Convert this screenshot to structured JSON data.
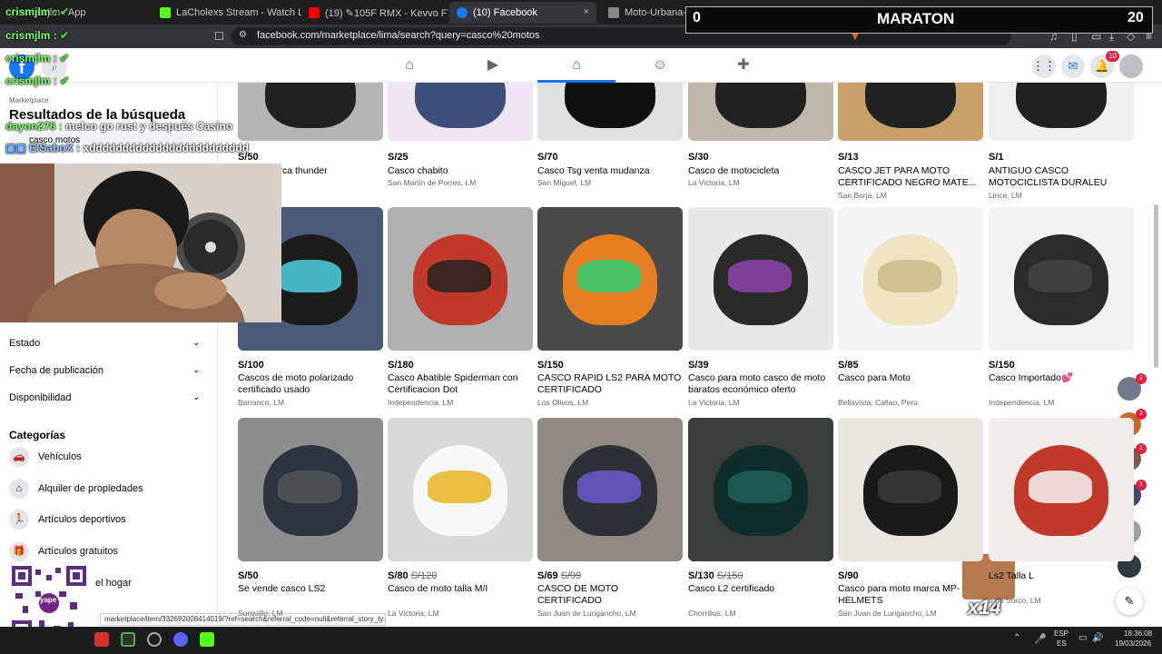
{
  "browser": {
    "tabs": [
      {
        "label": "crismjlm : App",
        "fav": "#333"
      },
      {
        "label": "LaCholexs Stream - Watch Live on Ki",
        "fav": "#53fc18"
      },
      {
        "label": "(19) ✎105F RMX - Kevvo FT Chench",
        "fav": "#ff0000"
      },
      {
        "label": "(10) Facebook",
        "fav": "#1877f2"
      },
      {
        "label": "Moto-Urbana-NK-250-1600X650.jp",
        "fav": "#888"
      }
    ],
    "new_tab": "+",
    "url": "facebook.com/marketplace/lima/search?query=casco%20motos",
    "close": "×"
  },
  "fb": {
    "notif_count": "10",
    "marketplace_label": "Marketplace",
    "search_results_title": "Resultados de la búsqueda",
    "search_query": "casco motos"
  },
  "sidebar": {
    "filters": [
      {
        "label": "Estado"
      },
      {
        "label": "Fecha de publicación"
      },
      {
        "label": "Disponibilidad"
      }
    ],
    "categories_title": "Categorías",
    "categories": [
      {
        "label": "Vehículos",
        "icon": "car-icon"
      },
      {
        "label": "Alquiler de propiedades",
        "icon": "home-icon"
      },
      {
        "label": "Artículos deportivos",
        "icon": "running-icon"
      },
      {
        "label": "Artículos gratuitos",
        "icon": "gift-icon"
      },
      {
        "label": "el hogar",
        "icon": "sofa-icon"
      }
    ]
  },
  "top_row": [
    {
      "price": "S/50",
      "title": "ficado marca thunder",
      "loc": ""
    },
    {
      "price": "S/25",
      "title": "Casco chabito",
      "loc": "San Martín de Porres, LM"
    },
    {
      "price": "S/70",
      "title": "Casco Tsg venta mudanza",
      "loc": "San Miguel, LM"
    },
    {
      "price": "S/30",
      "title": "Casco de motocicleta",
      "loc": "La Victoria, LM"
    },
    {
      "price": "S/13",
      "title": "CASCO JET PARA MOTO CERTIFICADO NEGRO MATE...",
      "loc": "San Borja, LM"
    },
    {
      "price": "S/1",
      "title": "ANTIGUO CASCO MOTOCICLISTA DURALEU FORTE",
      "loc": "Lince, LM"
    }
  ],
  "mid_row": [
    {
      "price": "S/100",
      "old": "",
      "title": "Cascos de moto polarizado certificado usado",
      "loc": "Barranco, LM"
    },
    {
      "price": "S/180",
      "old": "",
      "title": "Casco Abatible Spiderman con Certificacion Dot",
      "loc": "Independencia, LM"
    },
    {
      "price": "S/150",
      "old": "",
      "title": "CASCO RAPID LS2 PARA MOTO CERTIFICADO",
      "loc": "Los Olivos, LM"
    },
    {
      "price": "S/39",
      "old": "",
      "title": "Casco para moto casco de moto baratos económico oferto",
      "loc": "La Victoria, LM"
    },
    {
      "price": "S/85",
      "old": "",
      "title": "Casco para Moto",
      "loc": "Bellavista, Callao, Peru"
    },
    {
      "price": "S/150",
      "old": "",
      "title": "Casco Importado💕",
      "loc": "Independencia, LM"
    }
  ],
  "bot_row": [
    {
      "price": "S/50",
      "old": "",
      "title": "Se vende casco LS2",
      "loc": "Surquillo, LM"
    },
    {
      "price": "S/80",
      "old": "S/120",
      "title": "Casco de moto talla M/I",
      "loc": "La Victoria, LM"
    },
    {
      "price": "S/69",
      "old": "S/99",
      "title": "CASCO DE MOTO CERTIFICADO",
      "loc": "San Juan de Lurigancho, LM"
    },
    {
      "price": "S/130",
      "old": "S/150",
      "title": "Casco L2 certificado",
      "loc": "Chorrillos, LM"
    },
    {
      "price": "S/90",
      "old": "",
      "title": "Casco para moto marca MP-HELMETS",
      "loc": "San Juan de Lurigancho, LM"
    },
    {
      "price": "",
      "old": "",
      "title": "Ls2 Talla L",
      "loc": "o de Surco, LM"
    }
  ],
  "overlay": {
    "chat": [
      {
        "nick": "crismjlm :",
        "msg": ""
      },
      {
        "nick": "crismjlm :",
        "msg": ""
      },
      {
        "nick": "crismjlm :",
        "msg": ""
      },
      {
        "nick": "crismjlm :",
        "msg": ""
      },
      {
        "nick": "dayon278 :",
        "msg": "melco go rust y después Casino"
      },
      {
        "nick": "ElSaboX :",
        "msg": "xdddddddddddddddddddddddd"
      }
    ],
    "scoreboard": {
      "left": "0",
      "title": "MARATON",
      "right": "20"
    },
    "emote_count": "x14",
    "qr_label": "yape"
  },
  "status_url": "marketplace/item/332692008414019/?ref=search&referral_code=null&referral_story_ty...",
  "side_badges": [
    "2",
    "2",
    "1",
    "1"
  ],
  "taskbar": {
    "lang1": "ESP",
    "lang2": "ES",
    "time": "18:36:08",
    "date": "19/03/2026"
  }
}
